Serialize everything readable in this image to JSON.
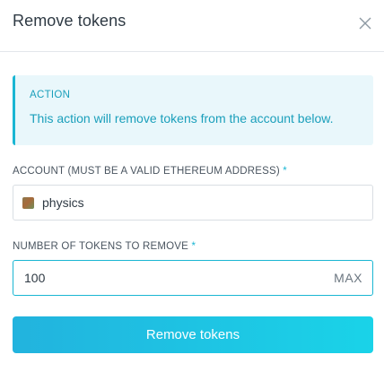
{
  "dialog": {
    "title": "Remove tokens"
  },
  "callout": {
    "heading": "ACTION",
    "message": "This action will remove tokens from the account below.",
    "accent_color": "#1ab6d3"
  },
  "account_field": {
    "label": "ACCOUNT (MUST BE A VALID ETHEREUM ADDRESS)",
    "required_marker": "*",
    "value": "physics",
    "icon": "avatar-identicon"
  },
  "tokens_field": {
    "label": "NUMBER OF TOKENS TO REMOVE",
    "required_marker": "*",
    "value": "100",
    "max_label": "MAX"
  },
  "submit": {
    "label": "Remove tokens",
    "color_start": "#22b3de",
    "color_end": "#1ad3e8"
  },
  "icons": {
    "close": "close-icon"
  }
}
